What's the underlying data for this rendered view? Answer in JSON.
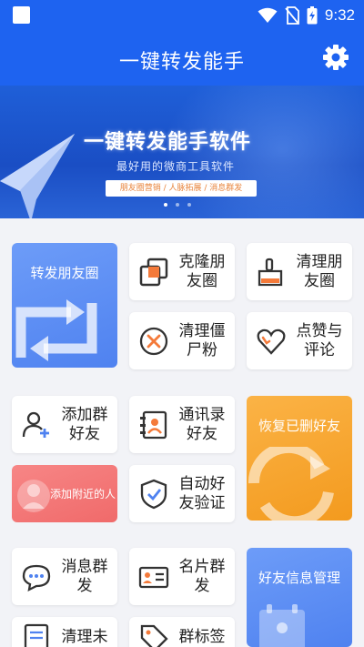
{
  "status_bar": {
    "time": "9:32"
  },
  "app_bar": {
    "title": "一键转发能手",
    "settings_icon": "gear-icon"
  },
  "banner": {
    "title": "一键转发能手软件",
    "subtitle": "最好用的微商工具软件",
    "pill": "朋友圈营销 / 人脉拓展 / 消息群发",
    "dots": 3,
    "active_dot": 0
  },
  "tiles": {
    "forward_moments": "转发朋友圈",
    "clone_moments": "克隆朋友圈",
    "clean_moments": "清理朋友圈",
    "clean_zombies": "清理僵尸粉",
    "likes_comments": "点赞与评论",
    "add_group_friends": "添加群好友",
    "contacts_friends": "通讯录好友",
    "restore_deleted": "恢复已删好友",
    "add_nearby": "添加附近的人",
    "auto_verify": "自动好友验证",
    "message_broadcast": "消息群发",
    "card_broadcast": "名片群发",
    "friend_info": "好友信息管理",
    "clean_unread": "清理未读",
    "group_tags": "群标签"
  },
  "colors": {
    "primary": "#1e63f0",
    "tile_blue": "#5b8ef5",
    "tile_orange": "#f7a22c",
    "tile_red": "#f47a7a"
  }
}
